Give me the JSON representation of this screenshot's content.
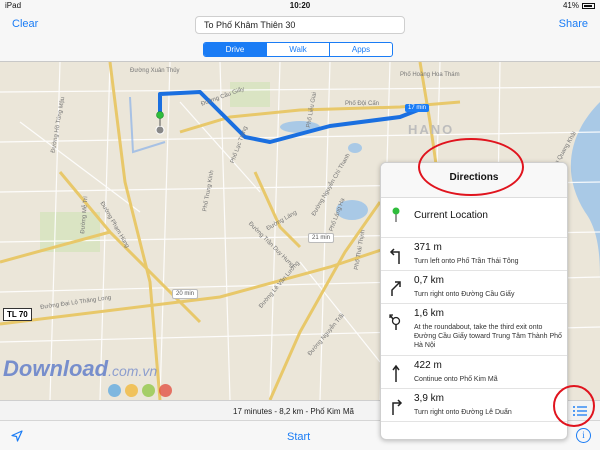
{
  "status": {
    "left": "iPad",
    "time": "10:20",
    "right": "41%"
  },
  "nav": {
    "clear": "Clear",
    "share": "Share",
    "destination": "To Phố Khâm Thiên 30",
    "modes": [
      {
        "label": "Drive",
        "active": true
      },
      {
        "label": "Walk",
        "active": false
      },
      {
        "label": "Apps",
        "active": false
      }
    ]
  },
  "map": {
    "city": "HANO",
    "badge_17": "17 min",
    "badge_21": "21 min",
    "badge_20": "20 min",
    "tl70": "TL 70",
    "labels": [
      "Đường Xuân Thủy",
      "Đường Cầu Giấy",
      "Đường Trần Duy Hưng",
      "Đường Láng",
      "Đường Nguyễn Trãi",
      "Đường Phạm Hùng",
      "Đường Mễ Trì",
      "Đường Đại Lộ Thăng Long",
      "Phố Đội Cấn",
      "Phố Lạc Trung",
      "Đường Hồ Tùng Mậu",
      "Phố Liễu Giai",
      "Đường Nguyễn Chí Thanh",
      "Phố Láng Hạ",
      "Đường Lê Văn Lương",
      "Phố Thái Thịnh",
      "Phố Trung Kính",
      "Phố Hoàng Hoa Thám",
      "Đường Quang Khải"
    ],
    "watermark": "Download",
    "watermark_suffix": ".com.vn"
  },
  "summary": "17 minutes - 8,2 km - Phố Kim Mã",
  "toolbar": {
    "start": "Start",
    "info": "i"
  },
  "directions": {
    "title": "Directions",
    "current": "Current Location",
    "steps": [
      {
        "distance": "371 m",
        "instruction": "Turn left onto Phố Trần Thái Tông",
        "icon": "turn-left-icon"
      },
      {
        "distance": "0,7 km",
        "instruction": "Turn right onto Đường Cầu Giấy",
        "icon": "bear-right-icon"
      },
      {
        "distance": "1,6 km",
        "instruction": "At the roundabout, take the third exit onto Đường Cầu Giấy toward Trung Tâm Thành Phố Hà Nội",
        "icon": "roundabout-icon"
      },
      {
        "distance": "422 m",
        "instruction": "Continue onto Phố Kim Mã",
        "icon": "straight-icon"
      },
      {
        "distance": "3,9 km",
        "instruction": "Turn right onto Đường Lê Duẩn",
        "icon": "turn-right-icon"
      }
    ]
  },
  "colors": {
    "accent": "#1a7cf5",
    "route": "#1a6fe0",
    "annotation": "#e0141e"
  }
}
